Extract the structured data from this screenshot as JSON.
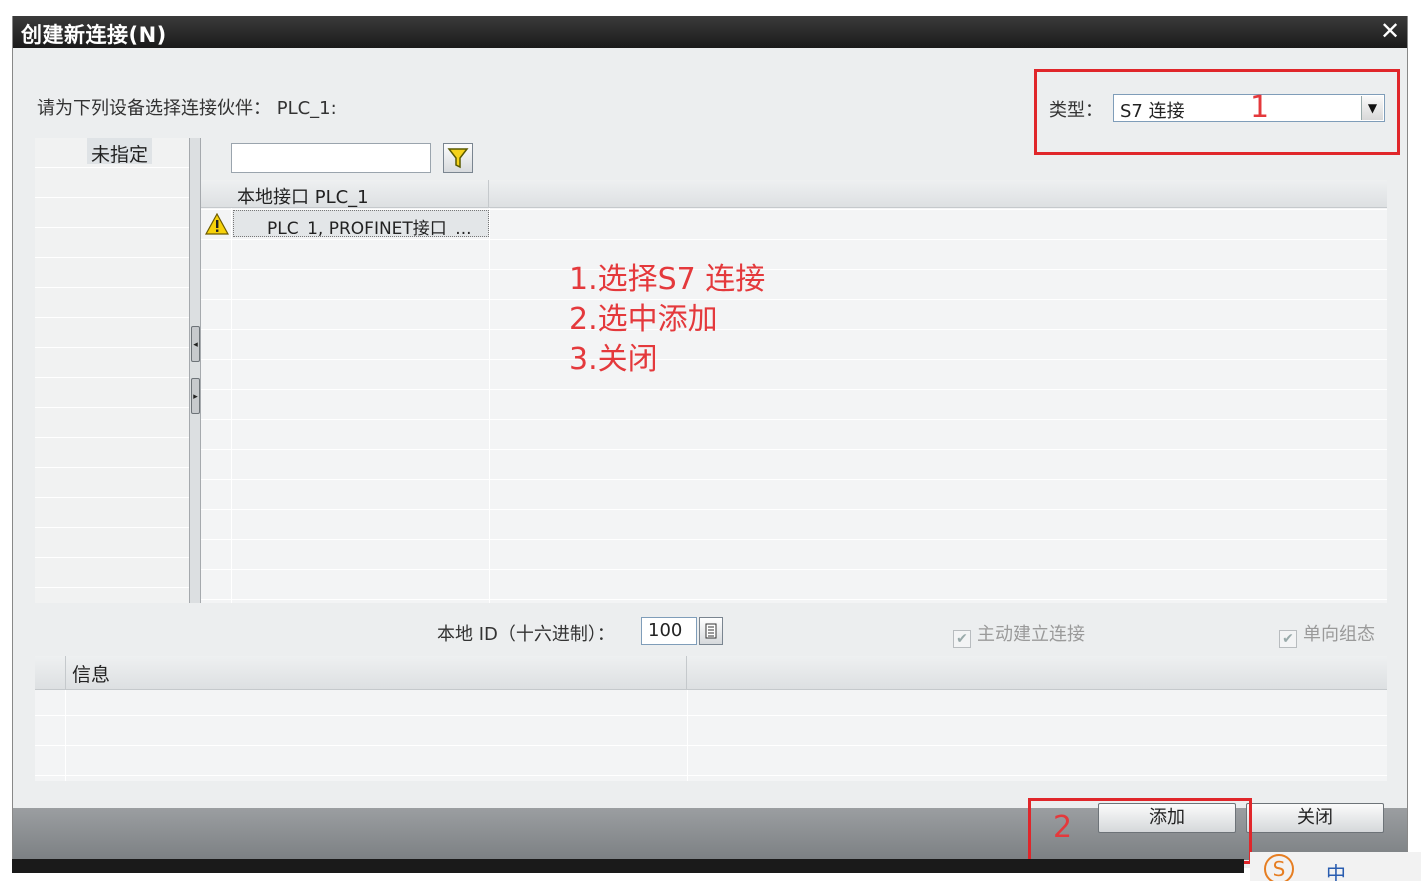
{
  "window": {
    "title": "创建新连接(N)",
    "close_glyph": "✕"
  },
  "prompt": "请为下列设备选择连接伙伴： PLC_1:",
  "type": {
    "label": "类型：",
    "value": "S7 连接",
    "dropdown_glyph": "▼"
  },
  "left_pane": {
    "header": "未指定"
  },
  "splitter": {
    "left_glyph": "◂",
    "right_glyph": "▸"
  },
  "filter": {
    "value": "",
    "placeholder": "",
    "icon": "filter-funnel-icon"
  },
  "grid": {
    "column_header": "本地接口 PLC_1",
    "rows": [
      {
        "warning": true,
        "label": "PLC_1, PROFINET接口_..."
      }
    ]
  },
  "notes": [
    "1.选择S7 连接",
    "2.选中添加",
    "3.关闭"
  ],
  "local_id": {
    "label": "本地 ID（十六进制）：",
    "value": "100"
  },
  "checkboxes": {
    "active_connect": {
      "label": "主动建立连接",
      "checked": true,
      "enabled": false
    },
    "one_way": {
      "label": "单向组态",
      "checked": true,
      "enabled": false
    }
  },
  "info": {
    "header": "信息"
  },
  "buttons": {
    "add": "添加",
    "close": "关闭"
  },
  "annotations": {
    "marker_1": "1",
    "marker_2": "2"
  },
  "tray": {
    "ime_char": "中",
    "s_glyph": "S"
  },
  "colors": {
    "annotation_red": "#e0262a",
    "titlebar": "#1a1a1a",
    "warning_yellow": "#f7d20a"
  }
}
